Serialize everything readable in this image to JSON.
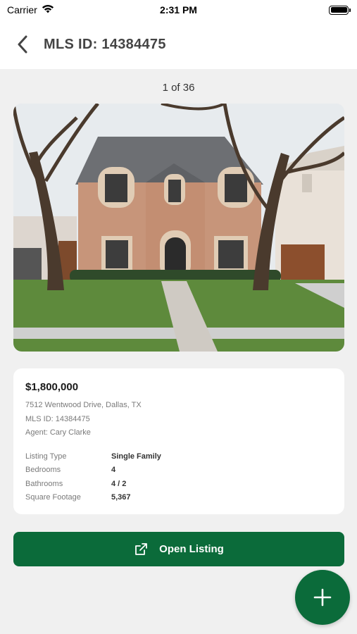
{
  "status_bar": {
    "carrier": "Carrier",
    "time": "2:31 PM"
  },
  "header": {
    "title": "MLS ID: 14384475",
    "back_icon": "chevron-left-icon"
  },
  "gallery": {
    "counter": "1 of 36"
  },
  "listing": {
    "price": "$1,800,000",
    "address": "7512 Wentwood Drive, Dallas, TX",
    "mls_line": "MLS ID: 14384475",
    "agent_line": "Agent: Cary Clarke",
    "details": [
      {
        "label": "Listing Type",
        "value": "Single Family"
      },
      {
        "label": "Bedrooms",
        "value": "4"
      },
      {
        "label": "Bathrooms",
        "value": "4 / 2"
      },
      {
        "label": "Square Footage",
        "value": "5,367"
      }
    ]
  },
  "actions": {
    "open_listing_label": "Open Listing",
    "open_listing_icon": "external-link-icon",
    "fab_icon": "plus-icon"
  },
  "colors": {
    "brand_green": "#0b6b3a",
    "background": "#f0f0f0",
    "card": "#ffffff"
  }
}
